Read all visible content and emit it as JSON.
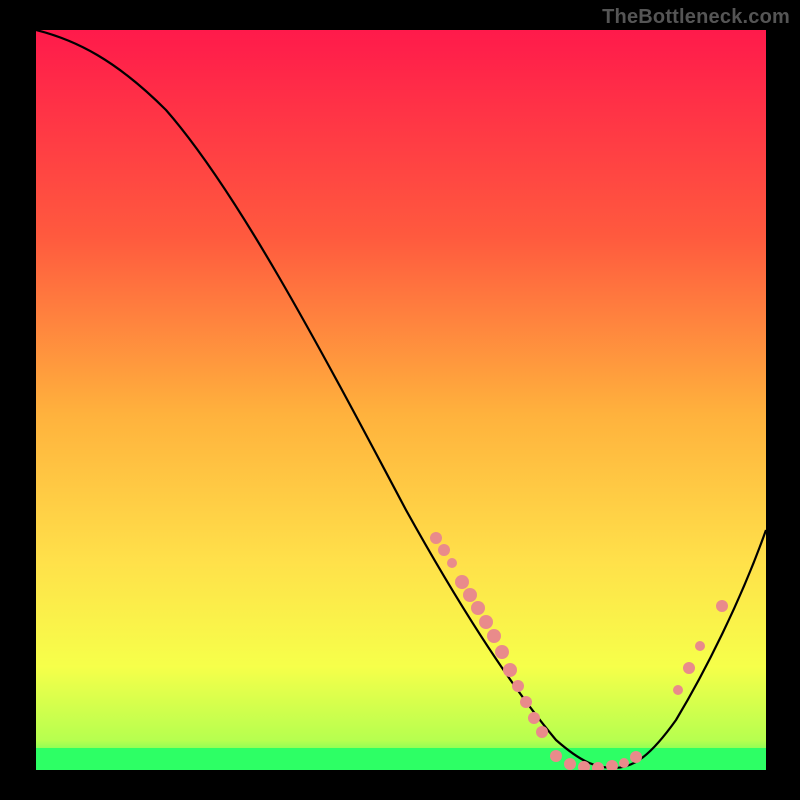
{
  "watermark": "TheBottleneck.com",
  "chart_data": {
    "type": "line",
    "title": "",
    "xlabel": "",
    "ylabel": "",
    "xlim": [
      0,
      100
    ],
    "ylim": [
      0,
      100
    ],
    "grid": false,
    "background_gradient": [
      "#ff1a4b",
      "#ff6a3c",
      "#ffc53d",
      "#ffe14a",
      "#f6ff4a",
      "#2dff65"
    ],
    "series": [
      {
        "name": "curve",
        "color": "#000000",
        "x": [
          0,
          6,
          12,
          18,
          24,
          30,
          36,
          42,
          48,
          54,
          58,
          62,
          66,
          70,
          74,
          78,
          82,
          86,
          90,
          94,
          100
        ],
        "y": [
          100,
          99,
          97,
          93,
          86,
          77,
          67,
          56,
          45,
          34,
          26,
          18,
          11,
          5,
          1,
          0,
          2,
          8,
          15,
          22,
          33
        ]
      },
      {
        "name": "markers-left-descent",
        "color": "#e98b8b",
        "type": "scatter",
        "x": [
          55,
          56,
          57,
          58.5,
          59.5,
          60.5,
          61.5,
          62.5,
          63.5,
          64.5,
          65.5,
          66.5,
          67.5,
          68.5
        ],
        "y": [
          32,
          30,
          28,
          25.5,
          24,
          22,
          20,
          18,
          15.5,
          13,
          11,
          9,
          7,
          5.3
        ]
      },
      {
        "name": "markers-valley",
        "color": "#e98b8b",
        "type": "scatter",
        "x": [
          71,
          73,
          75,
          77,
          79,
          80.5,
          82
        ],
        "y": [
          1.5,
          0.7,
          0.3,
          0.2,
          0.4,
          0.8,
          1.7
        ]
      },
      {
        "name": "markers-right-ascent",
        "color": "#e98b8b",
        "type": "scatter",
        "x": [
          88,
          89.5,
          91,
          94
        ],
        "y": [
          11,
          14,
          17,
          22
        ]
      }
    ],
    "band": {
      "name": "green-band",
      "color": "#2dff65",
      "y_range": [
        0,
        3
      ]
    }
  }
}
